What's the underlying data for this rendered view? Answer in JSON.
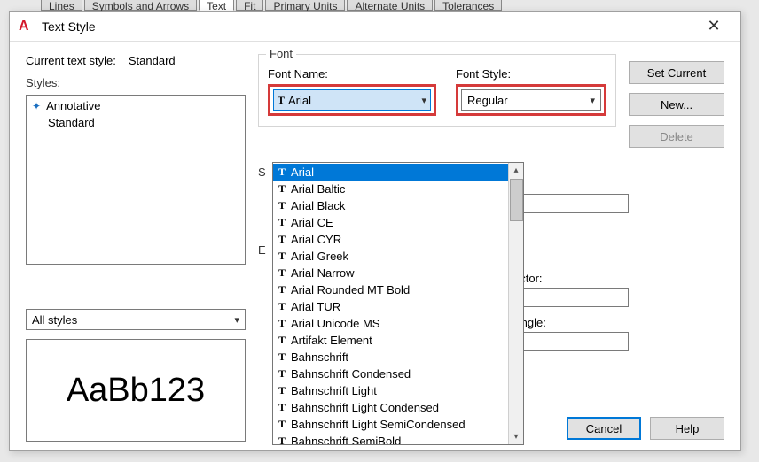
{
  "bg_tabs": [
    "Lines",
    "Symbols and Arrows",
    "Text",
    "Fit",
    "Primary Units",
    "Alternate Units",
    "Tolerances"
  ],
  "bg_active_tab": "Text",
  "dialog": {
    "title": "Text Style",
    "current_label": "Current text style:",
    "current_value": "Standard",
    "styles_label": "Styles:",
    "styles": [
      {
        "name": "Annotative",
        "annotative": true
      },
      {
        "name": "Standard",
        "annotative": false
      }
    ],
    "filter_label": "All styles",
    "preview": "AaBb123",
    "font": {
      "group": "Font",
      "name_label": "Font Name:",
      "name_value": "Arial",
      "style_label": "Font Style:",
      "style_value": "Regular",
      "options": [
        "Arial",
        "Arial Baltic",
        "Arial Black",
        "Arial CE",
        "Arial CYR",
        "Arial Greek",
        "Arial Narrow",
        "Arial Rounded MT Bold",
        "Arial TUR",
        "Arial Unicode MS",
        "Artifakt Element",
        "Bahnschrift",
        "Bahnschrift Condensed",
        "Bahnschrift Light",
        "Bahnschrift Light Condensed",
        "Bahnschrift Light SemiCondensed",
        "Bahnschrift SemiBold"
      ]
    },
    "size_group_hint": "S",
    "effects_group_hint": "E",
    "width_factor_label": "actor:",
    "oblique_label": "Angle:",
    "buttons": {
      "set_current": "Set Current",
      "new": "New...",
      "delete": "Delete",
      "cancel": "Cancel",
      "help": "Help"
    }
  }
}
